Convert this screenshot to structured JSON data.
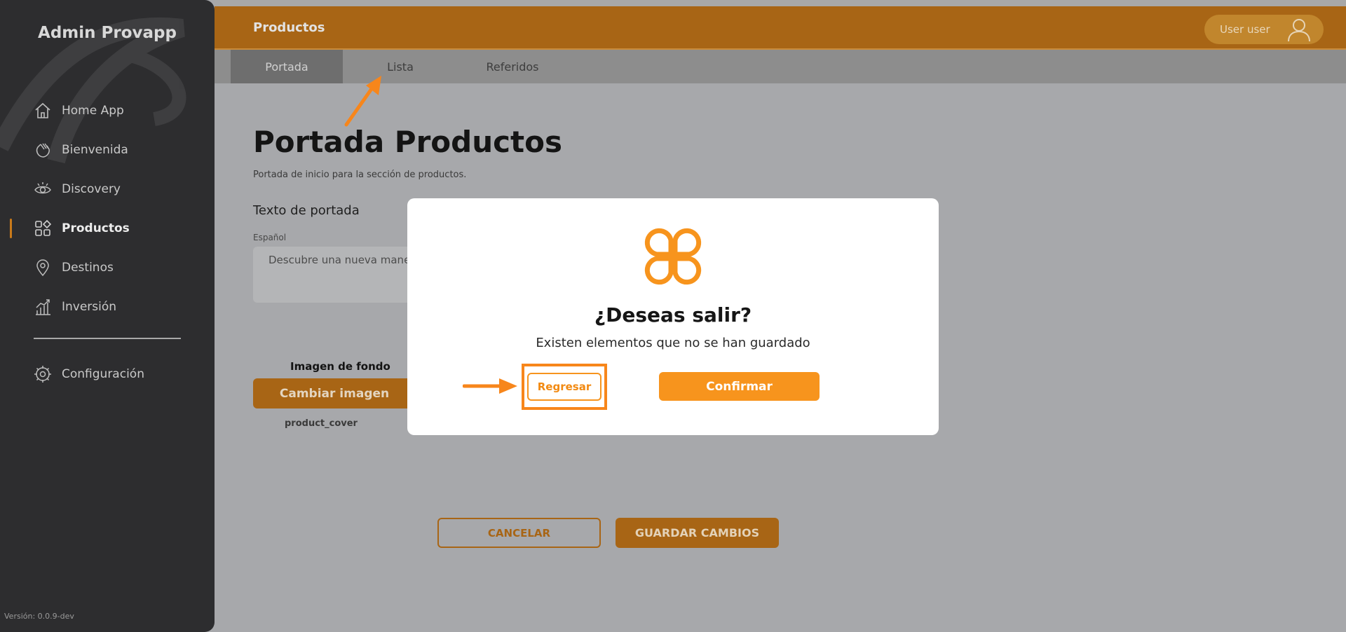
{
  "sidebar": {
    "brand": "Admin Provapp",
    "items": [
      {
        "label": "Home App",
        "icon": "home-icon",
        "active": false
      },
      {
        "label": "Bienvenida",
        "icon": "wave-hand-icon",
        "active": false
      },
      {
        "label": "Discovery",
        "icon": "eye-icon",
        "active": false
      },
      {
        "label": "Productos",
        "icon": "grid-icon",
        "active": true
      },
      {
        "label": "Destinos",
        "icon": "map-pin-icon",
        "active": false
      },
      {
        "label": "Inversión",
        "icon": "bar-chart-icon",
        "active": false
      }
    ],
    "config": {
      "label": "Configuración",
      "icon": "gear-icon"
    },
    "version": "Versión: 0.0.9-dev"
  },
  "header": {
    "title": "Productos",
    "user": "User user"
  },
  "tabs": [
    {
      "label": "Portada",
      "active": true
    },
    {
      "label": "Lista",
      "active": false
    },
    {
      "label": "Referidos",
      "active": false
    }
  ],
  "main": {
    "title": "Portada Productos",
    "subtitle": "Portada de inicio para la sección de productos.",
    "section_title": "Texto de portada",
    "lang_label": "Español",
    "textarea_value": "Descubre una nueva manera",
    "image_label": "Imagen de fondo",
    "change_image": "Cambiar imagen",
    "file_name": "product_cover",
    "cancel": "CANCELAR",
    "save": "GUARDAR CAMBIOS"
  },
  "modal": {
    "title": "¿Deseas salir?",
    "text": "Existen elementos que no se han guardado",
    "back": "Regresar",
    "confirm": "Confirmar"
  },
  "colors": {
    "accent": "#f7941d",
    "header_bg": "#a86515",
    "sidebar_bg": "#2d2d2f",
    "overlay_bg": "#a7a8ab",
    "annotation": "#f7861b"
  }
}
